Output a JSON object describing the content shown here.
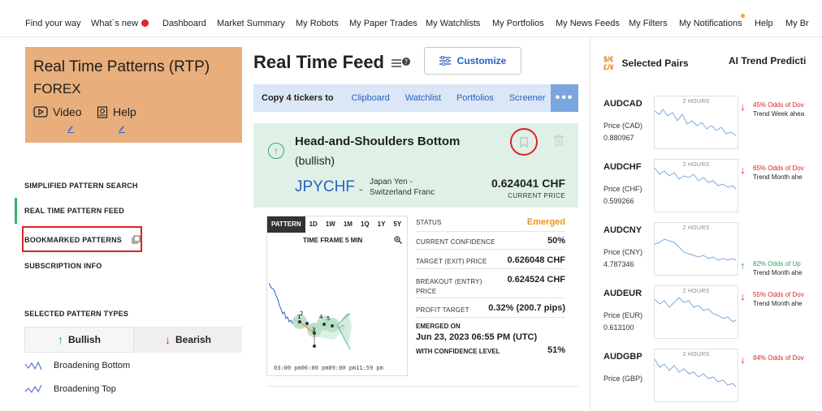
{
  "nav": {
    "items": [
      "Find your way",
      "What`s new",
      "Dashboard",
      "Market Summary",
      "My Robots",
      "My Paper Trades",
      "My Watchlists",
      "My Portfolios",
      "My News Feeds",
      "My Filters",
      "My Notifications",
      "Help",
      "My Br"
    ]
  },
  "rtp": {
    "title": "Real Time Patterns (RTP)",
    "market": "FOREX",
    "video_label": "Video",
    "help_label": "Help"
  },
  "leftnav": {
    "simplified": "SIMPLIFIED PATTERN SEARCH",
    "feed": "REAL TIME PATTERN FEED",
    "bookmarked": "BOOKMARKED PATTERNS",
    "subscription": "SUBSCRIPTION INFO",
    "types_title": "SELECTED PATTERN TYPES",
    "bullish": "Bullish",
    "bearish": "Bearish",
    "types": [
      "Broadening Bottom",
      "Broadening Top"
    ]
  },
  "feed": {
    "title": "Real Time Feed",
    "customize": "Customize",
    "copy_label": "Copy 4 tickers to",
    "copy_links": [
      "Clipboard",
      "Watchlist",
      "Portfolios",
      "Screener"
    ],
    "more": "•••"
  },
  "pattern": {
    "name": "Head-and-Shoulders Bottom",
    "bias": "(bullish)",
    "ticker": "JPYCHF",
    "ticker_name_1": "Japan Yen -",
    "ticker_name_2": "Switzerland Franc",
    "price": "0.624041 CHF",
    "price_label": "CURRENT PRICE",
    "tabs": [
      "PATTERN",
      "1D",
      "1W",
      "1M",
      "1Q",
      "1Y",
      "5Y"
    ],
    "timeframe": "TIME FRAME 5 MIN",
    "xaxis": "03:00 pm06:00 pm09:00 pm11:59 pm",
    "point_labels": [
      "1",
      "2",
      "3",
      "4",
      "5"
    ],
    "stats": {
      "status_k": "STATUS",
      "status_v": "Emerged",
      "conf_k": "CURRENT CONFIDENCE",
      "conf_v": "50%",
      "target_k": "TARGET (EXIT) PRICE",
      "target_v": "0.626048 CHF",
      "breakout_k1": "BREAKOUT (ENTRY)",
      "breakout_k2": "PRICE",
      "breakout_v": "0.624524 CHF",
      "profit_k": "PROFIT TARGET",
      "profit_v": "0.32% (200.7 pips)",
      "emerged_k": "EMERGED ON",
      "emerged_v": "Jun 23, 2023 06:55 PM (UTC)",
      "withconf_k": "WITH CONFIDENCE LEVEL",
      "withconf_v": "51%"
    },
    "colors": {
      "emerged": "#f0931c",
      "bullish": "#2aa65a",
      "bearish": "#e02020",
      "link": "#2a5fc4"
    }
  },
  "pairs": {
    "header": "Selected Pairs",
    "fx_icon": "$/€ £/¥",
    "ai_header": "AI Trend Predicti",
    "chart_label": "2 HOURS",
    "list": [
      {
        "sym": "AUDCAD",
        "plabel": "Price (CAD)",
        "pval": "0.880967",
        "odds": "45% Odds of Dov",
        "odds2": "Trend Week ahea",
        "dir": "down"
      },
      {
        "sym": "AUDCHF",
        "plabel": "Price (CHF)",
        "pval": "0.599266",
        "odds": "65% Odds of Dov",
        "odds2": "Trend Month ahe",
        "dir": "down"
      },
      {
        "sym": "AUDCNY",
        "plabel": "Price (CNY)",
        "pval": "4.787346",
        "odds": "82% Odds of Up",
        "odds2": "Trend Month ahe",
        "dir": "up"
      },
      {
        "sym": "AUDEUR",
        "plabel": "Price (EUR)",
        "pval": "0.613100",
        "odds": "55% Odds of Dov",
        "odds2": "Trend Month ahe",
        "dir": "down"
      },
      {
        "sym": "AUDGBP",
        "plabel": "Price (GBP)",
        "pval": "",
        "odds": "84% Odds of Dov",
        "odds2": "",
        "dir": "down"
      }
    ]
  }
}
